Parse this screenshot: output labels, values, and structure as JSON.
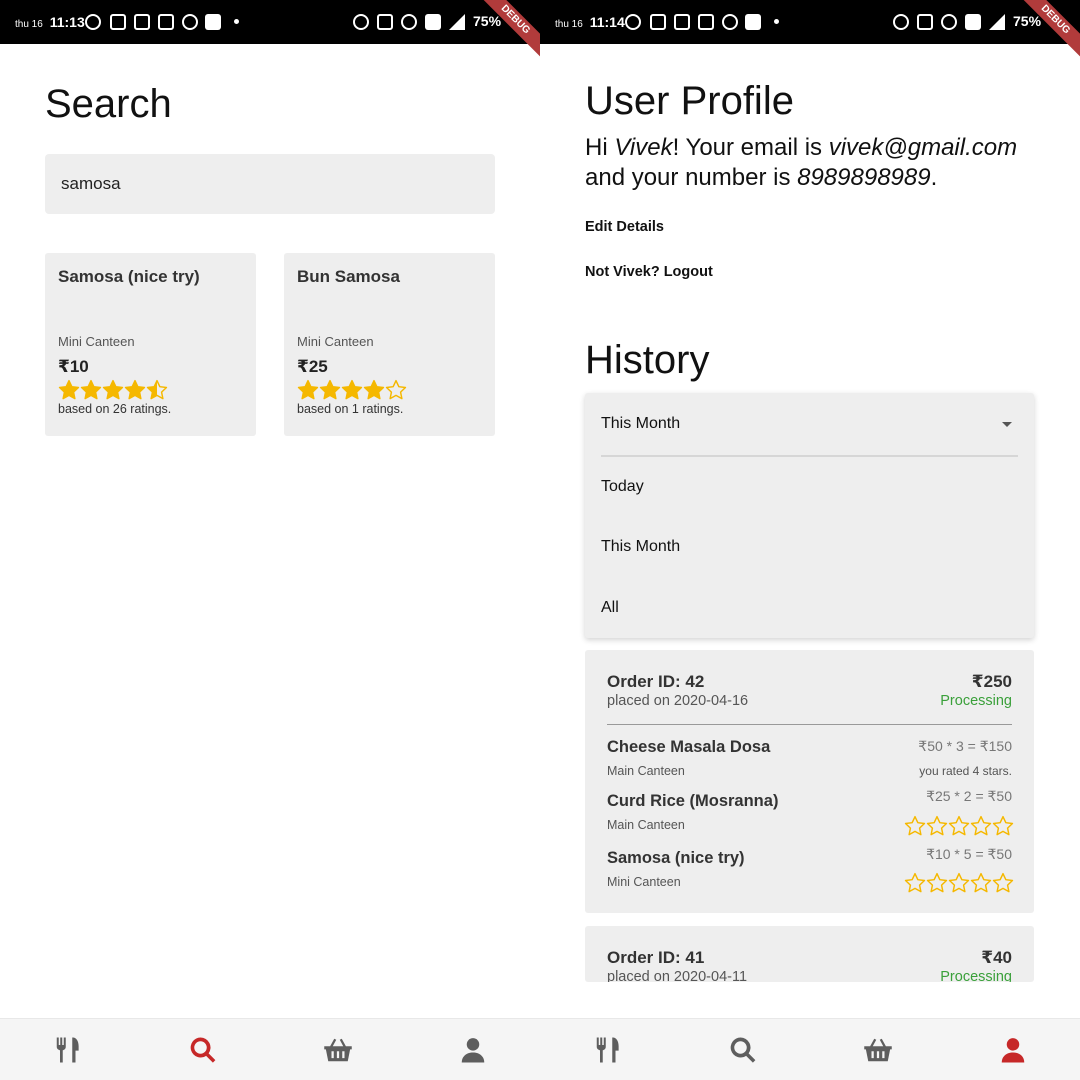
{
  "status_left": {
    "day": "thu 16",
    "time": "11:13",
    "battery": "75%",
    "debug": "DEBUG"
  },
  "status_right": {
    "day": "thu 16",
    "time": "11:14",
    "battery": "75%",
    "debug": "DEBUG"
  },
  "search_screen": {
    "title": "Search",
    "query": "samosa",
    "results": [
      {
        "name": "Samosa (nice try)",
        "canteen": "Mini Canteen",
        "price": "₹10",
        "rating": 4.5,
        "ratings_text": "based on 26 ratings."
      },
      {
        "name": "Bun Samosa",
        "canteen": "Mini Canteen",
        "price": "₹25",
        "rating": 4,
        "ratings_text": "based on 1 ratings."
      }
    ]
  },
  "profile_screen": {
    "title": "User Profile",
    "greeting_prefix": "Hi ",
    "name": "Vivek",
    "greeting_mid": "! Your email is ",
    "email": "vivek@gmail.com",
    "greeting_mid2": " and your number is ",
    "phone": "8989898989",
    "greeting_end": ".",
    "edit_details": "Edit Details",
    "logout": "Not Vivek? Logout",
    "history_title": "History",
    "filter": {
      "selected": "This Month",
      "options": [
        "Today",
        "This Month",
        "All"
      ]
    },
    "orders": [
      {
        "id_label": "Order ID: 42",
        "date_label": "placed on 2020-04-16",
        "total": "₹250",
        "status": "Processing",
        "items": [
          {
            "name": "Cheese Masala Dosa",
            "canteen": "Main Canteen",
            "calc": "₹50 * 3 = ₹150",
            "rated_text": "you rated 4 stars."
          },
          {
            "name": "Curd Rice (Mosranna)",
            "canteen": "Main Canteen",
            "calc": "₹25 * 2 = ₹50",
            "rating": 0
          },
          {
            "name": "Samosa (nice try)",
            "canteen": "Mini Canteen",
            "calc": "₹10 * 5 = ₹50",
            "rating": 0
          }
        ]
      },
      {
        "id_label": "Order ID: 41",
        "date_label": "placed on 2020-04-11",
        "total": "₹40",
        "status": "Processing"
      }
    ]
  },
  "nav": {
    "items": [
      "food-icon",
      "search-icon",
      "basket-icon",
      "user-icon"
    ],
    "active_left": "search-icon",
    "active_right": "user-icon",
    "active_color": "#c62828",
    "inactive_color": "#5e5e5e"
  },
  "colors": {
    "star": "#f5b800",
    "status_green": "#3aa03a",
    "card_bg": "#eeeeee"
  }
}
